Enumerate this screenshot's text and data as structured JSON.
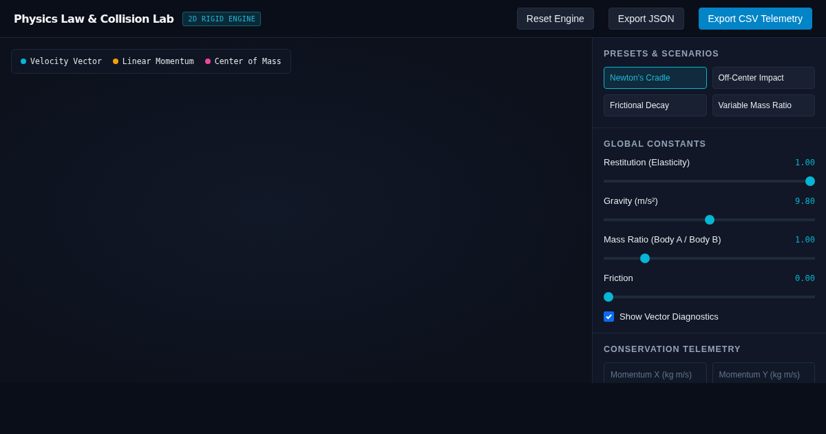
{
  "header": {
    "title": "Physics Law & Collision Lab",
    "badge": "2D RIGID ENGINE",
    "buttons": [
      {
        "label": "Reset Engine",
        "primary": false
      },
      {
        "label": "Export JSON",
        "primary": false
      },
      {
        "label": "Export CSV Telemetry",
        "primary": true
      }
    ]
  },
  "legend": [
    {
      "label": "Velocity Vector",
      "color": "#06b6d4"
    },
    {
      "label": "Linear Momentum",
      "color": "#f59e0b"
    },
    {
      "label": "Center of Mass",
      "color": "#ec4899"
    }
  ],
  "presets": {
    "heading": "PRESETS & SCENARIOS",
    "items": [
      {
        "label": "Newton's Cradle",
        "selected": true
      },
      {
        "label": "Off-Center Impact",
        "selected": false
      },
      {
        "label": "Frictional Decay",
        "selected": false
      },
      {
        "label": "Variable Mass Ratio",
        "selected": false
      }
    ]
  },
  "constants": {
    "heading": "GLOBAL CONSTANTS",
    "sliders": [
      {
        "label": "Restitution (Elasticity)",
        "reading": "1.00",
        "level": 1
      },
      {
        "label": "Gravity (m/s²)",
        "reading": "9.80",
        "level": 0.5
      },
      {
        "label": "Mass Ratio (Body A / Body B)",
        "reading": "1.00",
        "level": 0.18
      },
      {
        "label": "Friction",
        "reading": "0.00",
        "level": 0
      }
    ],
    "checkbox": {
      "label": "Show Vector Diagnostics",
      "checked": true
    }
  },
  "telemetry": {
    "heading": "CONSERVATION TELEMETRY",
    "cards": [
      {
        "label": "Momentum X (kg m/s)"
      },
      {
        "label": "Momentum Y (kg m/s)"
      }
    ]
  }
}
